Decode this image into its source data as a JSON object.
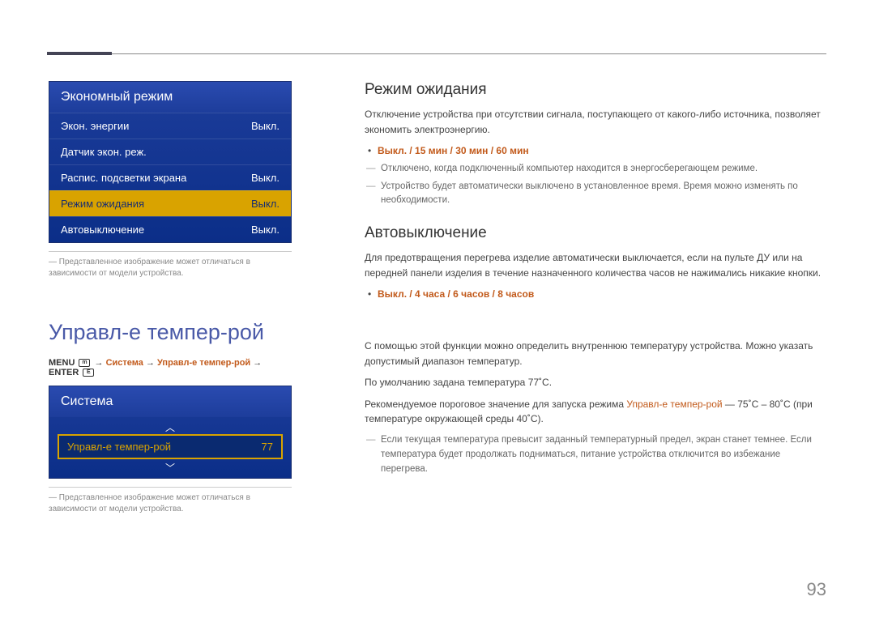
{
  "page_number": "93",
  "disclaimer": "Представленное изображение может отличаться в зависимости от модели устройства.",
  "menu1": {
    "title": "Экономный режим",
    "rows": [
      {
        "label": "Экон. энергии",
        "value": "Выкл."
      },
      {
        "label": "Датчик экон. реж.",
        "value": ""
      },
      {
        "label": "Распис. подсветки экрана",
        "value": "Выкл."
      },
      {
        "label": "Режим ожидания",
        "value": "Выкл.",
        "selected": true
      },
      {
        "label": "Автовыключение",
        "value": "Выкл."
      }
    ]
  },
  "section2_title": "Управл-е темпер-рой",
  "breadcrumb": {
    "menu": "MENU",
    "sys": "Система",
    "item": "Управл-е темпер-рой",
    "enter": "ENTER"
  },
  "menu2": {
    "title": "Система",
    "item_label": "Управл-е темпер-рой",
    "item_value": "77"
  },
  "right": {
    "h_standby": "Режим ожидания",
    "standby_p1": "Отключение устройства при отсутствии сигнала, поступающего от какого-либо источника, позволяет экономить электроэнергию.",
    "standby_opts": "Выкл. / 15 мин / 30 мин / 60 мин",
    "standby_d1": "Отключено, когда подключенный компьютер находится в энергосберегающем режиме.",
    "standby_d2": "Устройство будет автоматически выключено в установленное время. Время можно изменять по необходимости.",
    "h_autooff": "Автовыключение",
    "autooff_p1": "Для предотвращения перегрева изделие автоматически выключается, если на пульте ДУ или на передней панели изделия в течение назначенного количества часов не нажимались никакие кнопки.",
    "autooff_opts": "Выкл. / 4 часа / 6 часов / 8 часов",
    "temp_p1": "С помощью этой функции можно определить внутреннюю температуру устройства. Можно указать допустимый диапазон температур.",
    "temp_p2": "По умолчанию задана температура 77˚C.",
    "temp_p3a": "Рекомендуемое пороговое значение для запуска режима ",
    "temp_p3b": "Управл-е темпер-рой",
    "temp_p3c": " — 75˚C – 80˚C (при температуре окружающей среды 40˚C).",
    "temp_d1": "Если текущая температура превысит заданный температурный предел, экран станет темнее. Если температура будет продолжать подниматься, питание устройства отключится во избежание перегрева."
  }
}
